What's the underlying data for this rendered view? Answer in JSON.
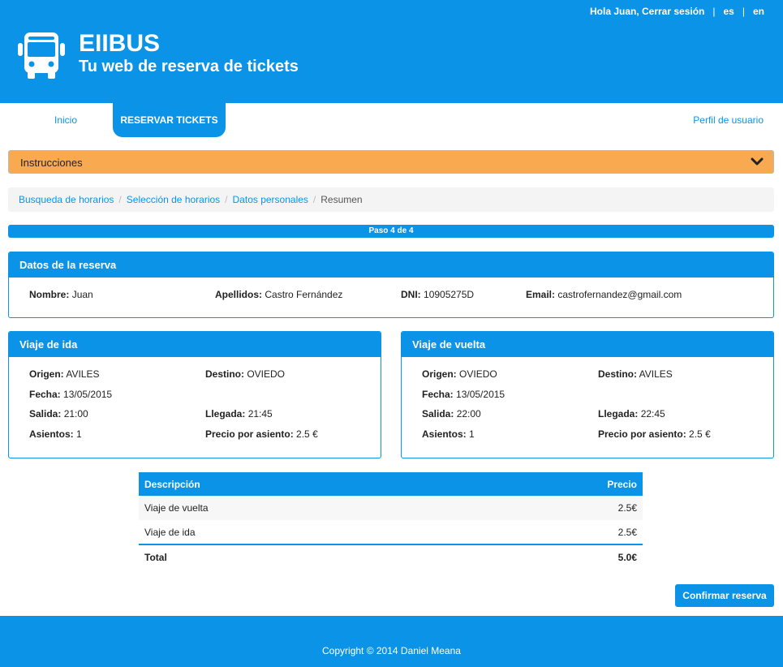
{
  "header": {
    "greeting_prefix": "Hola Juan, ",
    "logout": "Cerrar sesión",
    "lang_es": "es",
    "lang_en": "en",
    "separator": "|",
    "app_name": "EIIBUS",
    "tagline": "Tu web de reserva de tickets",
    "logo_icon": "bus-icon"
  },
  "nav": {
    "home": "Inicio",
    "reserve": "RESERVAR TICKETS",
    "profile": "Perfil de usuario"
  },
  "instructions": {
    "label": "Instrucciones",
    "icon": "chevron-down-icon"
  },
  "breadcrumb": {
    "items": [
      "Busqueda de horarios",
      "Selección de horarios",
      "Datos personales",
      "Resumen"
    ],
    "separator": "/"
  },
  "progress": {
    "label": "Paso 4 de 4",
    "percent": 100
  },
  "reservation": {
    "title": "Datos de la reserva",
    "name_label": "Nombre:",
    "name_value": "Juan",
    "surname_label": "Apellidos:",
    "surname_value": "Castro Fernández",
    "dni_label": "DNI:",
    "dni_value": "10905275D",
    "email_label": "Email:",
    "email_value": "castrofernandez@gmail.com"
  },
  "outbound": {
    "title": "Viaje de ida",
    "origin_label": "Origen:",
    "origin_value": "AVILES",
    "destination_label": "Destino:",
    "destination_value": "OVIEDO",
    "date_label": "Fecha:",
    "date_value": "13/05/2015",
    "departure_label": "Salida:",
    "departure_value": "21:00",
    "arrival_label": "Llegada:",
    "arrival_value": "21:45",
    "seats_label": "Asientos:",
    "seats_value": "1",
    "price_label": "Precio por asiento:",
    "price_value": "2.5 €"
  },
  "return": {
    "title": "Viaje de vuelta",
    "origin_label": "Origen:",
    "origin_value": "OVIEDO",
    "destination_label": "Destino:",
    "destination_value": "AVILES",
    "date_label": "Fecha:",
    "date_value": "13/05/2015",
    "departure_label": "Salida:",
    "departure_value": "22:00",
    "arrival_label": "Llegada:",
    "arrival_value": "22:45",
    "seats_label": "Asientos:",
    "seats_value": "1",
    "price_label": "Precio por asiento:",
    "price_value": "2.5 €"
  },
  "summary": {
    "col_description": "Descripción",
    "col_price": "Precio",
    "rows": [
      {
        "description": "Viaje de vuelta",
        "price": "2.5€"
      },
      {
        "description": "Viaje de ida",
        "price": "2.5€"
      }
    ],
    "total_label": "Total",
    "total_value": "5.0€"
  },
  "confirm_button": "Confirmar reserva",
  "footer": {
    "copyright": "Copyright © 2014 Daniel Meana"
  },
  "colors": {
    "primary": "#0b93e8",
    "instructions_bg": "#f9a94f"
  }
}
